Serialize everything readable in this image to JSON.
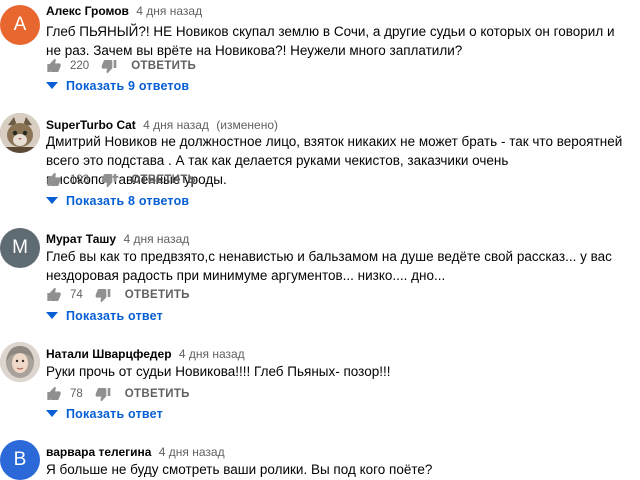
{
  "comments": [
    {
      "author": "Алекс Громов",
      "time": "4 дня назад",
      "edited": "",
      "avatar_letter": "А",
      "avatar_color": "#e8672e",
      "avatar_icon": "letter",
      "text": "Глеб ПЬЯНЫЙ?! НЕ Новиков скупал землю в Сочи, а другие судьи о которых он говорил и не раз. Зачем вы врёте на Новикова?! Неужели много заплатили?",
      "likes": "220",
      "reply_label": "ОТВЕТИТЬ",
      "replies_label": "Показать 9 ответов"
    },
    {
      "author": "SuperTurbo Cat",
      "time": "4 дня назад",
      "edited": "(изменено)",
      "avatar_letter": "",
      "avatar_color": "#8a7a60",
      "avatar_icon": "cat-photo",
      "text": "Дмитрий Новиков не должностное лицо, взяток никаких не может брать - так что вероятней всего это подстава . А так как делается руками чекистов, заказчики очень высокопоставленные уроды.",
      "likes": "193",
      "reply_label": "ОТВЕТИТЬ",
      "replies_label": "Показать 8 ответов"
    },
    {
      "author": "Мурат Ташу",
      "time": "4 дня назад",
      "edited": "",
      "avatar_letter": "M",
      "avatar_color": "#5f6b73",
      "avatar_icon": "letter",
      "text": "Глеб вы как то предвзято,с ненавистью и бальзамом на душе ведёте свой рассказ... у вас нездоровая радость при минимуме аргументов... низко.... дно...",
      "likes": "74",
      "reply_label": "ОТВЕТИТЬ",
      "replies_label": "Показать ответ"
    },
    {
      "author": "Натали Шварцфедер",
      "time": "4 дня назад",
      "edited": "",
      "avatar_letter": "",
      "avatar_color": "#c9b8a8",
      "avatar_icon": "portrait-photo",
      "text": "Руки прочь от судьи Новикова!!!! Глеб Пьяных- позор!!!",
      "likes": "78",
      "reply_label": "ОТВЕТИТЬ",
      "replies_label": "Показать ответ"
    },
    {
      "author": "варвара телегина",
      "time": "4 дня назад",
      "edited": "",
      "avatar_letter": "B",
      "avatar_color": "#2b69d8",
      "avatar_icon": "letter",
      "text": "Я больше не буду смотреть ваши ролики. Вы под кого поёте?",
      "likes": "",
      "reply_label": "",
      "replies_label": ""
    }
  ]
}
